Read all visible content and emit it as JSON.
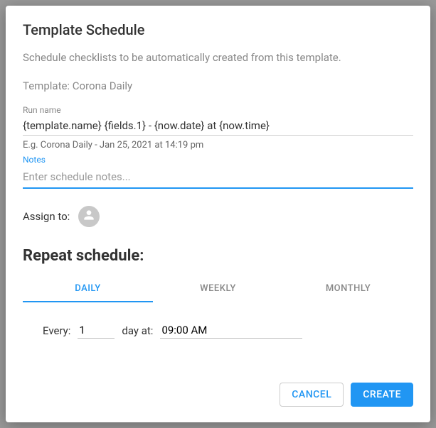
{
  "modal": {
    "title": "Template Schedule",
    "description": "Schedule checklists to be automatically created from this template.",
    "template_label": "Template: Corona Daily",
    "run_name": {
      "label": "Run name",
      "value": "{template.name} {fields.1} - {now.date} at {now.time}",
      "example": "E.g. Corona Daily - Jan 25, 2021 at 14:19 pm"
    },
    "notes": {
      "label": "Notes",
      "placeholder": "Enter schedule notes...",
      "value": ""
    },
    "assign": {
      "label": "Assign to:"
    },
    "repeat": {
      "title": "Repeat schedule:",
      "tabs": {
        "daily": "DAILY",
        "weekly": "WEEKLY",
        "monthly": "MONTHLY"
      },
      "every_label": "Every:",
      "every_value": "1",
      "day_at_label": "day at:",
      "time_value": "09:00 AM"
    },
    "buttons": {
      "cancel": "CANCEL",
      "create": "CREATE"
    }
  }
}
